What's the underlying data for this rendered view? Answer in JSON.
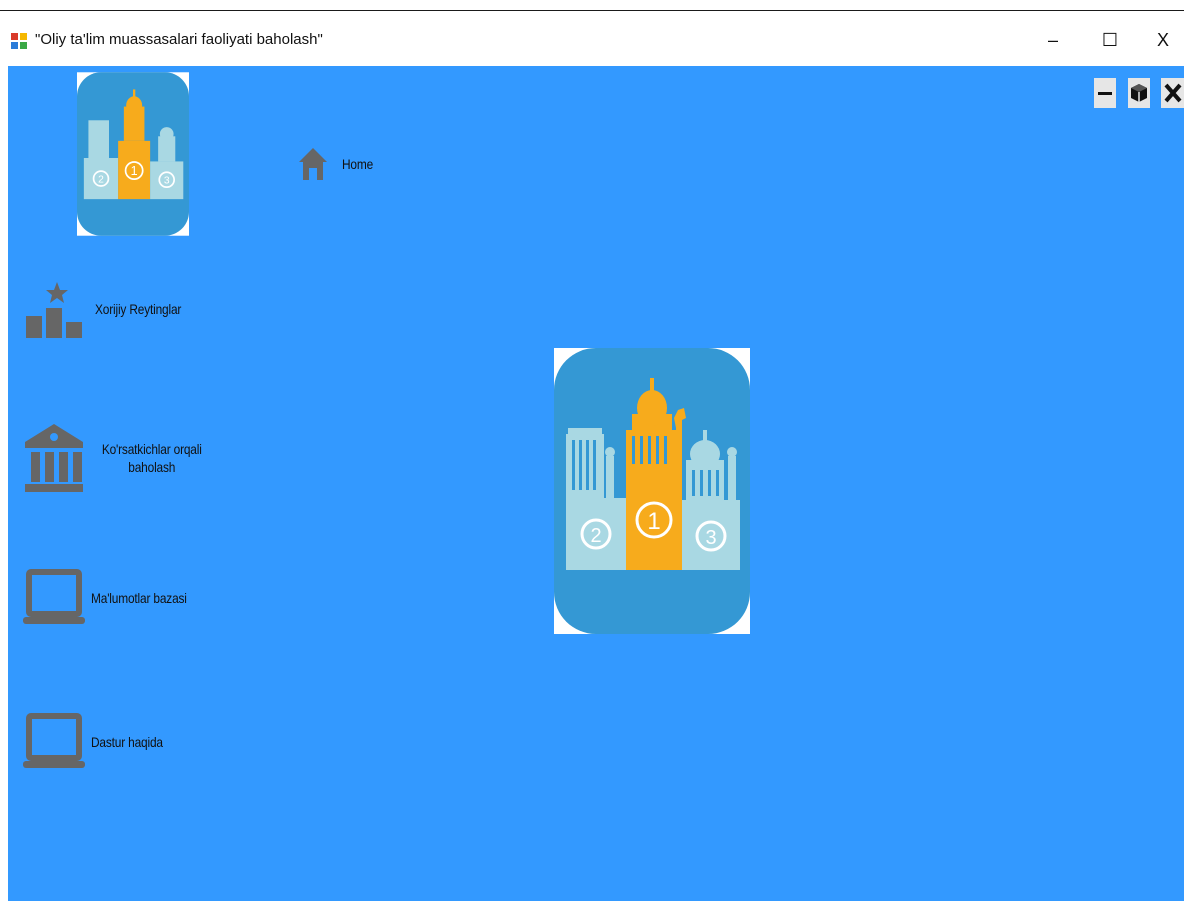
{
  "window": {
    "title": "\"Oliy ta'lim muassasalari faoliyati baholash\"",
    "minimize_glyph": "–",
    "maximize_glyph": "☐",
    "close_glyph": "X"
  },
  "header": {
    "home_label": "Home"
  },
  "sidebar": {
    "items": [
      {
        "label": "Xorijiy Reytinglar",
        "icon": "podium-star-icon"
      },
      {
        "label_line1": "Ko'rsatkichlar orqali",
        "label_line2": "baholash",
        "icon": "institution-icon"
      },
      {
        "label": "Ma'lumotlar bazasi",
        "icon": "laptop-icon"
      },
      {
        "label": "Dastur haqida",
        "icon": "laptop-icon"
      }
    ]
  },
  "logo": {
    "places": [
      "2",
      "1",
      "3"
    ]
  },
  "colors": {
    "background": "#3399ff",
    "logo_bg": "#3498d4",
    "gold": "#f7ab1c",
    "pale": "#a9d8e3",
    "icon_gray": "#666666"
  }
}
